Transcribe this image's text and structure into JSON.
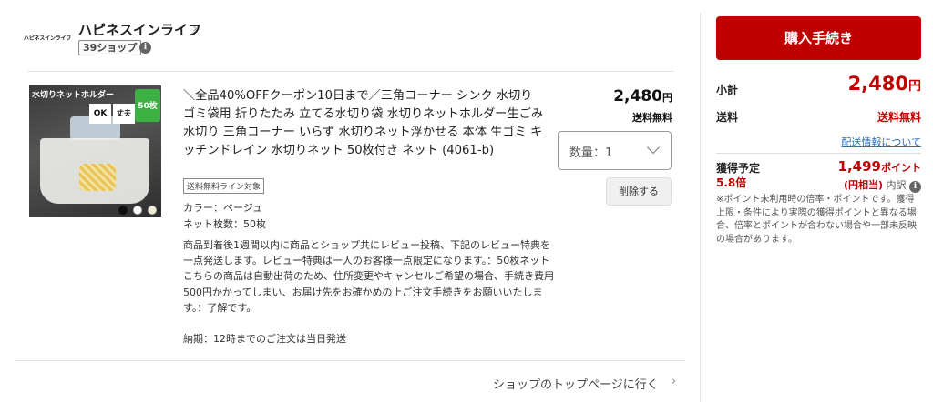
{
  "shop": {
    "logo_text": "ハピネスインライフ",
    "name": "ハピネスインライフ",
    "badge": "39ショップ"
  },
  "product": {
    "image_tag": "水切りネットホルダー",
    "image_badge_ok": "OK",
    "image_badge_strong": "丈夫",
    "image_pack": "50枚",
    "title": "＼全品40%OFFクーポン10日まで／三角コーナー シンク 水切り ゴミ袋用 折りたたみ 立てる水切り袋 水切りネットホルダー生ごみ水切り 三角コーナー いらず 水切りネット浮かせる 本体 生ゴミ キッチンドレイン 水切りネット 50枚付き ネット (4061-b)",
    "shipping_line_badge": "送料無料ライン対象",
    "color": "カラー：ベージュ",
    "net_count": "ネット枚数：50枚",
    "note": "商品到着後1週間以内に商品とショップ共にレビュー投稿、下記のレビュー特典を一点発送します。レビュー特典は一人のお客様一点限定になります。：50枚ネット こちらの商品は自動出荷のため、住所変更やキャンセルご希望の場合、手続き費用500円かかってしまい、お届け先をお確かめの上ご注文手続きをお願いいたします。：了解です。",
    "delivery": "納期：12時までのご注文は当日発送",
    "price_value": "2,480",
    "price_unit": "円",
    "shipping": "送料無料",
    "quantity_label": "数量：1",
    "delete_label": "削除する"
  },
  "footer": {
    "top_link": "ショップのトップページに行く"
  },
  "summary": {
    "buy_label": "購入手続き",
    "subtotal_label": "小計",
    "subtotal_value": "2,480",
    "subtotal_unit": "円",
    "shipping_label": "送料",
    "shipping_value": "送料無料",
    "shipping_info_link": "配送情報について",
    "points_label": "獲得予定",
    "points_rate": "5.8倍",
    "points_value": "1,499",
    "points_unit": "ポイント",
    "points_yen": "(円相当)",
    "points_breakdown": "内訳",
    "points_note": "※ポイント未利用時の倍率・ポイントです。獲得上限・条件により実際の獲得ポイントと異なる場合、倍率とポイントが合わない場合や一部未反映の場合があります。"
  },
  "colors": {
    "accent": "#bf0000",
    "link": "#2a6ebb"
  },
  "icons": [
    "chevron-right-icon",
    "info-icon",
    "chevron-down-icon"
  ]
}
